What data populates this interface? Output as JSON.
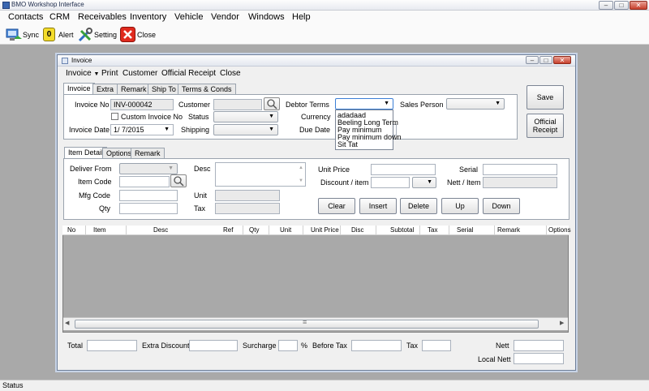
{
  "app": {
    "title": "BMO Workshop Interface",
    "status": "Status"
  },
  "window_controls": {
    "minimize": "–",
    "maximize": "□",
    "close": "✕"
  },
  "menu": [
    "Contacts",
    "CRM",
    "Receivables",
    "Inventory",
    "Vehicle",
    "Vendor",
    "Windows",
    "Help"
  ],
  "toolbar": {
    "sync": "Sync",
    "alert": "Alert",
    "alert_count": "0",
    "setting": "Setting",
    "close": "Close"
  },
  "invoice": {
    "title": "Invoice",
    "menu": {
      "invoice": "Invoice",
      "print": "Print",
      "customer": "Customer",
      "official_receipt": "Official Receipt",
      "close": "Close"
    },
    "tabs": [
      "Invoice",
      "Extra",
      "Remark",
      "Ship To",
      "Terms & Conds"
    ],
    "labels": {
      "invoice_no": "Invoice No",
      "custom_invoice_no": "Custom Invoice No",
      "invoice_date": "Invoice Date",
      "customer": "Customer",
      "status": "Status",
      "shipping": "Shipping",
      "debtor_terms": "Debtor Terms",
      "currency": "Currency",
      "due_date": "Due Date",
      "sales_person": "Sales Person"
    },
    "values": {
      "invoice_no": "INV-000042",
      "invoice_date": "1/  7/2015"
    },
    "buttons": {
      "save": "Save",
      "official_receipt_1": "Official",
      "official_receipt_2": "Receipt"
    },
    "debtor_terms_options": [
      "adadaad",
      "Beeling Long Term",
      "Pay minimum",
      "Pay minimum down",
      "Sit Tat"
    ],
    "detail_tabs": [
      "Item Detail",
      "Options",
      "Remark"
    ],
    "detail_labels": {
      "deliver_from": "Deliver From",
      "item_code": "Item Code",
      "mfg_code": "Mfg Code",
      "qty": "Qty",
      "desc": "Desc",
      "unit": "Unit",
      "tax": "Tax",
      "unit_price": "Unit Price",
      "discount_item": "Discount / item",
      "serial": "Serial",
      "nett_item": "Nett / Item"
    },
    "detail_buttons": {
      "clear": "Clear",
      "insert": "Insert",
      "delete": "Delete",
      "up": "Up",
      "down": "Down"
    },
    "grid_columns": [
      "No",
      "Item",
      "Desc",
      "Ref",
      "Qty",
      "Unit",
      "Unit Price",
      "Disc",
      "Subtotal",
      "Tax",
      "Serial",
      "Remark",
      "Options"
    ],
    "totals": {
      "total": "Total",
      "extra_discount": "Extra Discount",
      "surcharge": "Surcharge",
      "percent": "%",
      "before_tax": "Before Tax",
      "tax": "Tax",
      "nett": "Nett",
      "local_nett": "Local Nett"
    }
  }
}
